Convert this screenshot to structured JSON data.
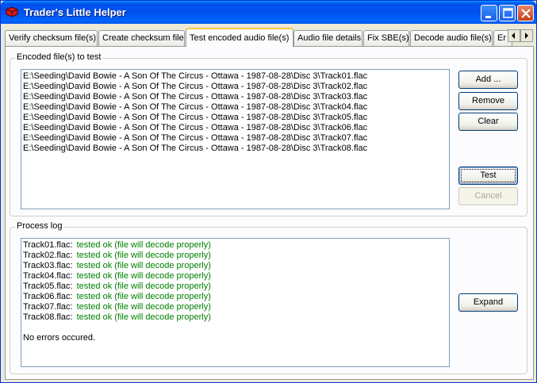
{
  "window": {
    "title": "Trader's Little Helper"
  },
  "tabs": [
    {
      "label": "Verify checksum file(s)"
    },
    {
      "label": "Create checksum file"
    },
    {
      "label": "Test encoded audio file(s)"
    },
    {
      "label": "Audio file details"
    },
    {
      "label": "Fix SBE(s)"
    },
    {
      "label": "Decode audio file(s)"
    },
    {
      "label": "Er"
    }
  ],
  "encoded_group": {
    "label": "Encoded file(s) to test",
    "files": [
      "E:\\Seeding\\David Bowie - A Son Of The Circus - Ottawa - 1987-08-28\\Disc 3\\Track01.flac",
      "E:\\Seeding\\David Bowie - A Son Of The Circus - Ottawa - 1987-08-28\\Disc 3\\Track02.flac",
      "E:\\Seeding\\David Bowie - A Son Of The Circus - Ottawa - 1987-08-28\\Disc 3\\Track03.flac",
      "E:\\Seeding\\David Bowie - A Son Of The Circus - Ottawa - 1987-08-28\\Disc 3\\Track04.flac",
      "E:\\Seeding\\David Bowie - A Son Of The Circus - Ottawa - 1987-08-28\\Disc 3\\Track05.flac",
      "E:\\Seeding\\David Bowie - A Son Of The Circus - Ottawa - 1987-08-28\\Disc 3\\Track06.flac",
      "E:\\Seeding\\David Bowie - A Son Of The Circus - Ottawa - 1987-08-28\\Disc 3\\Track07.flac",
      "E:\\Seeding\\David Bowie - A Son Of The Circus - Ottawa - 1987-08-28\\Disc 3\\Track08.flac"
    ],
    "buttons": {
      "add": "Add ...",
      "remove": "Remove",
      "clear": "Clear",
      "test": "Test",
      "cancel": "Cancel"
    }
  },
  "process_log": {
    "label": "Process log",
    "entries": [
      {
        "file": "Track01.flac:",
        "status": "tested ok (file will decode properly)"
      },
      {
        "file": "Track02.flac:",
        "status": "tested ok (file will decode properly)"
      },
      {
        "file": "Track03.flac:",
        "status": "tested ok (file will decode properly)"
      },
      {
        "file": "Track04.flac:",
        "status": "tested ok (file will decode properly)"
      },
      {
        "file": "Track05.flac:",
        "status": "tested ok (file will decode properly)"
      },
      {
        "file": "Track06.flac:",
        "status": "tested ok (file will decode properly)"
      },
      {
        "file": "Track07.flac:",
        "status": "tested ok (file will decode properly)"
      },
      {
        "file": "Track08.flac:",
        "status": "tested ok (file will decode properly)"
      }
    ],
    "summary": "No errors occured.",
    "expand_label": "Expand"
  },
  "colors": {
    "titlebar": "#0053ee",
    "ok_text": "#008000",
    "active_tab_accent": "#ffc83c"
  }
}
